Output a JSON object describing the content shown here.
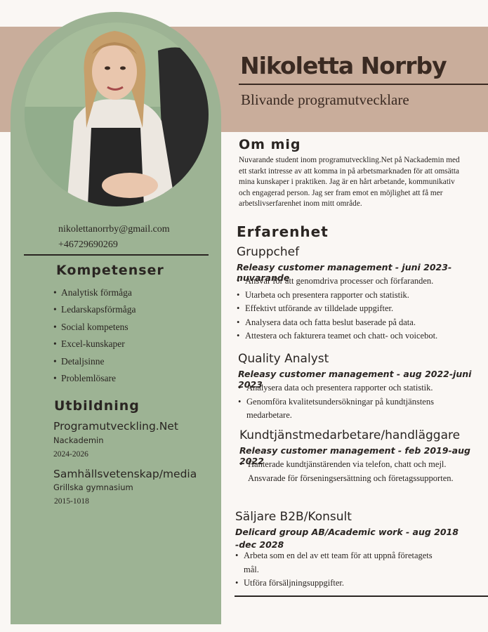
{
  "header": {
    "name": "Nikoletta Norrby",
    "title": "Blivande programutvecklare"
  },
  "about": {
    "heading": "Om mig",
    "text": "Nuvarande student inom programutveckling.Net på Nackademin med ett starkt intresse av att komma in på arbetsmarknaden för att omsätta mina kunskaper i praktiken. Jag är en hårt arbetande, kommunikativ och engagerad person. Jag ser fram emot en möjlighet att få mer arbetslivserfarenhet inom mitt område."
  },
  "contact": {
    "email": "nikolettanorrby@gmail.com",
    "phone": "+46729690269"
  },
  "skills": {
    "heading": "Kompetenser",
    "items": [
      "Analytisk förmåga",
      "Ledarskapsförmåga",
      "Social kompetens",
      "Excel-kunskaper",
      "Detaljsinne",
      "Problemlösare"
    ]
  },
  "education": {
    "heading": "Utbildning",
    "items": [
      {
        "title": "Programutveckling.Net",
        "school": "Nackademin",
        "years": "2024-2026"
      },
      {
        "title": "Samhällsvetenskap/media",
        "school": "Grillska gymnasium",
        "years": "2015-1018"
      }
    ]
  },
  "experience": {
    "heading": "Erfarenhet",
    "jobs": [
      {
        "title": "Gruppchef",
        "meta": "Releasy customer management - juni 2023-nuvarande",
        "bullets": [
          "Ansvar för att genomdriva processer och förfaranden.",
          "Utarbeta och presentera rapporter och statistik.",
          "Effektivt utförande av tilldelade uppgifter.",
          "Analysera data och fatta beslut baserade på data.",
          "Attestera och fakturera teamet och chatt- och voicebot."
        ]
      },
      {
        "title": "Quality Analyst",
        "meta": "Releasy customer management - aug 2022-juni 2023",
        "bullets": [
          "Analysera data och presentera rapporter och statistik.",
          "Genomföra kvalitetsundersökningar på kundtjänstens medarbetare."
        ]
      },
      {
        "title": "Kundtjänstmedarbetare/handläggare",
        "meta": "Releasy customer management - feb 2019-aug 2022",
        "bullets": [
          "Hanterade kundtjänstärenden via telefon, chatt och mejl. Ansvarade för förseningsersättning och företagssupporten."
        ]
      },
      {
        "title": "Säljare B2B/Konsult",
        "meta": "Delicard group AB/Academic work - aug 2018 -dec 2028",
        "bullets": [
          "Arbeta som en del av ett team för att uppnå företagets mål.",
          "Utföra försäljningsuppgifter."
        ]
      }
    ]
  },
  "colors": {
    "sidebar": "#9db394",
    "header_band": "#c9ad9b",
    "background": "#faf7f4",
    "text": "#2a2522"
  }
}
